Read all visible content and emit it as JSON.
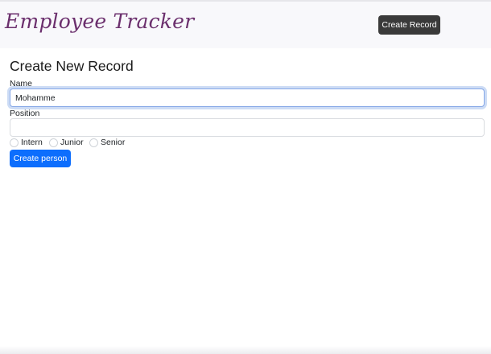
{
  "navbar": {
    "brand": "Employee Tracker",
    "create_record_label": "Create Record"
  },
  "form": {
    "title": "Create New Record",
    "name": {
      "label": "Name",
      "value": "Mohamme"
    },
    "position": {
      "label": "Position",
      "value": ""
    },
    "levels": [
      {
        "label": "Intern",
        "checked": false
      },
      {
        "label": "Junior",
        "checked": false
      },
      {
        "label": "Senior",
        "checked": false
      }
    ],
    "submit_label": "Create person"
  },
  "colors": {
    "brand": "#6b2f6d",
    "nav_button": "#3a3a3a",
    "primary_button": "#0d6efd",
    "focus_border": "#86a8e7"
  }
}
